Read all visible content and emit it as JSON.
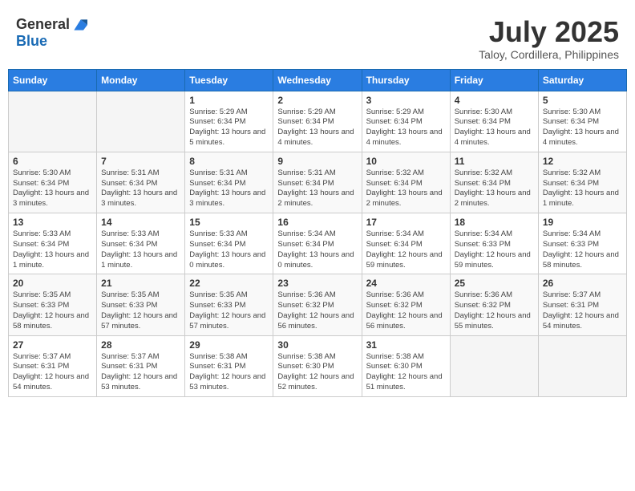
{
  "header": {
    "logo_general": "General",
    "logo_blue": "Blue",
    "title": "July 2025",
    "location": "Taloy, Cordillera, Philippines"
  },
  "weekdays": [
    "Sunday",
    "Monday",
    "Tuesday",
    "Wednesday",
    "Thursday",
    "Friday",
    "Saturday"
  ],
  "weeks": [
    [
      {
        "day": "",
        "empty": true
      },
      {
        "day": "",
        "empty": true
      },
      {
        "day": "1",
        "sunrise": "5:29 AM",
        "sunset": "6:34 PM",
        "daylight": "13 hours and 5 minutes."
      },
      {
        "day": "2",
        "sunrise": "5:29 AM",
        "sunset": "6:34 PM",
        "daylight": "13 hours and 4 minutes."
      },
      {
        "day": "3",
        "sunrise": "5:29 AM",
        "sunset": "6:34 PM",
        "daylight": "13 hours and 4 minutes."
      },
      {
        "day": "4",
        "sunrise": "5:30 AM",
        "sunset": "6:34 PM",
        "daylight": "13 hours and 4 minutes."
      },
      {
        "day": "5",
        "sunrise": "5:30 AM",
        "sunset": "6:34 PM",
        "daylight": "13 hours and 4 minutes."
      }
    ],
    [
      {
        "day": "6",
        "sunrise": "5:30 AM",
        "sunset": "6:34 PM",
        "daylight": "13 hours and 3 minutes."
      },
      {
        "day": "7",
        "sunrise": "5:31 AM",
        "sunset": "6:34 PM",
        "daylight": "13 hours and 3 minutes."
      },
      {
        "day": "8",
        "sunrise": "5:31 AM",
        "sunset": "6:34 PM",
        "daylight": "13 hours and 3 minutes."
      },
      {
        "day": "9",
        "sunrise": "5:31 AM",
        "sunset": "6:34 PM",
        "daylight": "13 hours and 2 minutes."
      },
      {
        "day": "10",
        "sunrise": "5:32 AM",
        "sunset": "6:34 PM",
        "daylight": "13 hours and 2 minutes."
      },
      {
        "day": "11",
        "sunrise": "5:32 AM",
        "sunset": "6:34 PM",
        "daylight": "13 hours and 2 minutes."
      },
      {
        "day": "12",
        "sunrise": "5:32 AM",
        "sunset": "6:34 PM",
        "daylight": "13 hours and 1 minute."
      }
    ],
    [
      {
        "day": "13",
        "sunrise": "5:33 AM",
        "sunset": "6:34 PM",
        "daylight": "13 hours and 1 minute."
      },
      {
        "day": "14",
        "sunrise": "5:33 AM",
        "sunset": "6:34 PM",
        "daylight": "13 hours and 1 minute."
      },
      {
        "day": "15",
        "sunrise": "5:33 AM",
        "sunset": "6:34 PM",
        "daylight": "13 hours and 0 minutes."
      },
      {
        "day": "16",
        "sunrise": "5:34 AM",
        "sunset": "6:34 PM",
        "daylight": "13 hours and 0 minutes."
      },
      {
        "day": "17",
        "sunrise": "5:34 AM",
        "sunset": "6:34 PM",
        "daylight": "12 hours and 59 minutes."
      },
      {
        "day": "18",
        "sunrise": "5:34 AM",
        "sunset": "6:33 PM",
        "daylight": "12 hours and 59 minutes."
      },
      {
        "day": "19",
        "sunrise": "5:34 AM",
        "sunset": "6:33 PM",
        "daylight": "12 hours and 58 minutes."
      }
    ],
    [
      {
        "day": "20",
        "sunrise": "5:35 AM",
        "sunset": "6:33 PM",
        "daylight": "12 hours and 58 minutes."
      },
      {
        "day": "21",
        "sunrise": "5:35 AM",
        "sunset": "6:33 PM",
        "daylight": "12 hours and 57 minutes."
      },
      {
        "day": "22",
        "sunrise": "5:35 AM",
        "sunset": "6:33 PM",
        "daylight": "12 hours and 57 minutes."
      },
      {
        "day": "23",
        "sunrise": "5:36 AM",
        "sunset": "6:32 PM",
        "daylight": "12 hours and 56 minutes."
      },
      {
        "day": "24",
        "sunrise": "5:36 AM",
        "sunset": "6:32 PM",
        "daylight": "12 hours and 56 minutes."
      },
      {
        "day": "25",
        "sunrise": "5:36 AM",
        "sunset": "6:32 PM",
        "daylight": "12 hours and 55 minutes."
      },
      {
        "day": "26",
        "sunrise": "5:37 AM",
        "sunset": "6:31 PM",
        "daylight": "12 hours and 54 minutes."
      }
    ],
    [
      {
        "day": "27",
        "sunrise": "5:37 AM",
        "sunset": "6:31 PM",
        "daylight": "12 hours and 54 minutes."
      },
      {
        "day": "28",
        "sunrise": "5:37 AM",
        "sunset": "6:31 PM",
        "daylight": "12 hours and 53 minutes."
      },
      {
        "day": "29",
        "sunrise": "5:38 AM",
        "sunset": "6:31 PM",
        "daylight": "12 hours and 53 minutes."
      },
      {
        "day": "30",
        "sunrise": "5:38 AM",
        "sunset": "6:30 PM",
        "daylight": "12 hours and 52 minutes."
      },
      {
        "day": "31",
        "sunrise": "5:38 AM",
        "sunset": "6:30 PM",
        "daylight": "12 hours and 51 minutes."
      },
      {
        "day": "",
        "empty": true
      },
      {
        "day": "",
        "empty": true
      }
    ]
  ]
}
